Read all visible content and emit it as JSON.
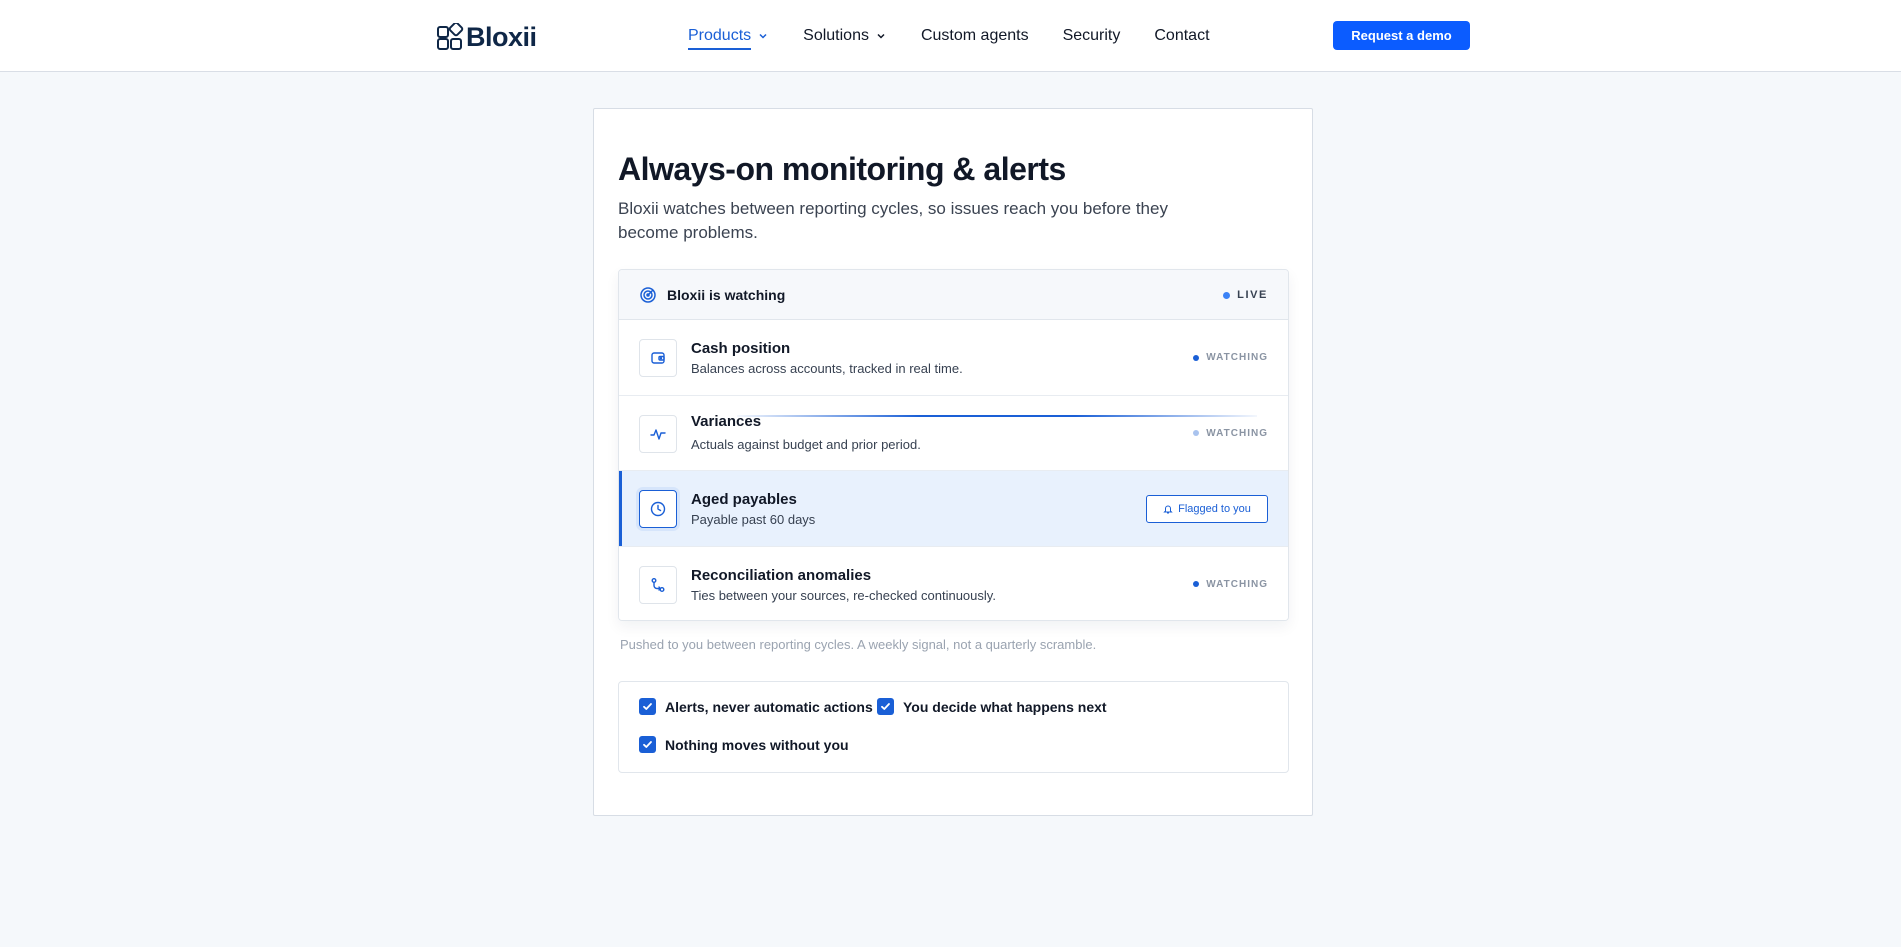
{
  "brand": {
    "name": "Bloxii"
  },
  "nav": {
    "items": [
      {
        "label": "Products",
        "active": true,
        "dropdown": true
      },
      {
        "label": "Solutions",
        "active": false,
        "dropdown": true
      },
      {
        "label": "Custom agents",
        "active": false,
        "dropdown": false
      },
      {
        "label": "Security",
        "active": false,
        "dropdown": false
      },
      {
        "label": "Contact",
        "active": false,
        "dropdown": false
      }
    ],
    "cta_label": "Request a demo"
  },
  "main": {
    "title": "Always-on monitoring & alerts",
    "subtitle": "Bloxii watches between reporting cycles, so issues reach you before they become problems.",
    "panel": {
      "header_title": "Bloxii is watching",
      "live_label": "LIVE",
      "rows": [
        {
          "title": "Cash position",
          "desc": "Balances across accounts, tracked in real time.",
          "icon": "wallet-icon",
          "status": "WATCHING"
        },
        {
          "title": "Variances",
          "desc": "Actuals against budget and prior period.",
          "icon": "pulse-icon",
          "status": "WATCHING"
        },
        {
          "title": "Aged payables",
          "desc": "Payable past 60 days",
          "icon": "clock-icon",
          "flag_label": "Flagged to you"
        },
        {
          "title": "Reconciliation anomalies",
          "desc": "Ties between your sources, re-checked continuously.",
          "icon": "git-compare-icon",
          "status": "WATCHING"
        }
      ]
    },
    "footnote": "Pushed to you between reporting cycles. A weekly signal, not a quarterly scramble.",
    "checks": [
      {
        "label": "Alerts, never automatic actions",
        "checked": true
      },
      {
        "label": "You decide what happens next",
        "checked": true
      },
      {
        "label": "Nothing moves without you",
        "checked": true
      }
    ]
  },
  "colors": {
    "accent": "#1a5fd6",
    "cta": "#0b5cff",
    "background": "#f5f8fb",
    "flagged_row": "#e8f1fd"
  }
}
